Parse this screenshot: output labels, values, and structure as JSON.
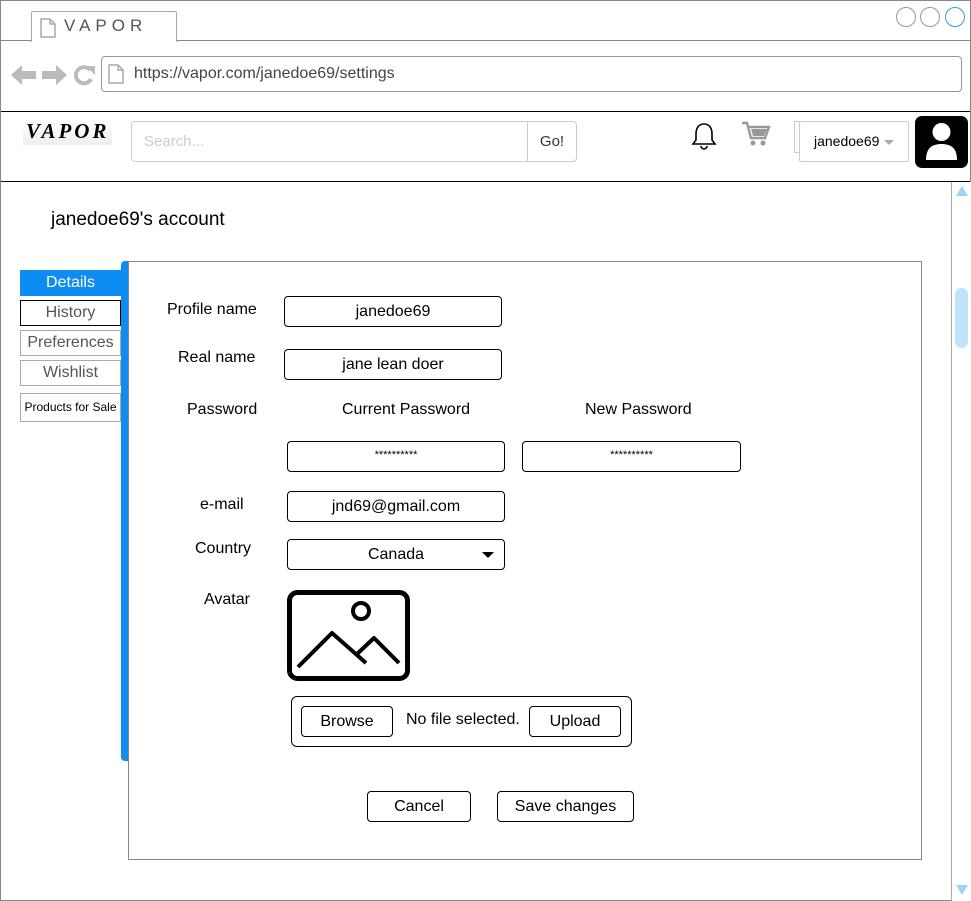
{
  "browser": {
    "tab_title": "VAPOR",
    "url": "https://vapor.com/janedoe69/settings"
  },
  "header": {
    "logo": "VAPOR",
    "search_placeholder": "Search...",
    "go_label": "Go!",
    "username": "janedoe69"
  },
  "page": {
    "title": "janedoe69's account"
  },
  "sidebar": {
    "items": [
      {
        "label": "Details",
        "active": true
      },
      {
        "label": "History",
        "active": false
      },
      {
        "label": "Preferences",
        "active": false
      },
      {
        "label": "Wishlist",
        "active": false
      },
      {
        "label": "Products for Sale",
        "active": false
      }
    ]
  },
  "form": {
    "profile_name_label": "Profile name",
    "profile_name_value": "janedoe69",
    "real_name_label": "Real name",
    "real_name_value": "jane lean doer",
    "password_label": "Password",
    "current_password_label": "Current Password",
    "current_password_value": "**********",
    "new_password_label": "New Password",
    "new_password_value": "**********",
    "email_label": "e-mail",
    "email_value": "jnd69@gmail.com",
    "country_label": "Country",
    "country_value": "Canada",
    "avatar_label": "Avatar",
    "browse_label": "Browse",
    "no_file_text": "No file selected.",
    "upload_label": "Upload",
    "cancel_label": "Cancel",
    "save_label": "Save changes"
  },
  "colors": {
    "accent": "#0d8cf3",
    "scroll": "#9cd3f8"
  }
}
